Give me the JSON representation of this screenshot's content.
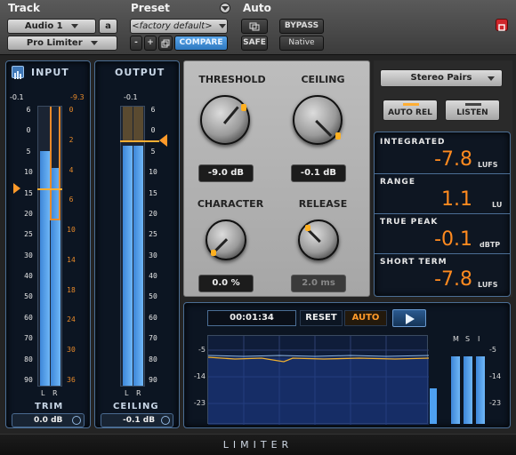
{
  "header": {
    "track_label": "Track",
    "track_name": "Audio 1",
    "track_variant": "a",
    "plugin_name": "Pro Limiter",
    "preset_label": "Preset",
    "preset_name": "<factory default>",
    "minus": "-",
    "plus": "+",
    "compare": "COMPARE",
    "auto_label": "Auto",
    "safe": "SAFE",
    "bypass": "BYPASS",
    "native": "Native"
  },
  "input": {
    "title": "INPUT",
    "peak_left": "-0.1",
    "peak_right": "-9.3",
    "scale_white": [
      "6",
      "0",
      "5",
      "10",
      "15",
      "20",
      "25",
      "30",
      "40",
      "50",
      "60",
      "70",
      "80",
      "90"
    ],
    "scale_orange": [
      "0",
      "2",
      "4",
      "6",
      "10",
      "14",
      "18",
      "24",
      "30",
      "36"
    ],
    "ch_l": "L",
    "ch_r": "R",
    "trim_label": "TRIM",
    "trim_value": "0.0 dB",
    "level_left": 0.84,
    "level_right": 0.78
  },
  "output": {
    "title": "OUTPUT",
    "peak": "-0.1",
    "scale": [
      "6",
      "0",
      "5",
      "10",
      "15",
      "20",
      "25",
      "30",
      "40",
      "50",
      "60",
      "70",
      "80",
      "90"
    ],
    "ch_l": "L",
    "ch_r": "R",
    "ceiling_label": "CEILING",
    "ceiling_value": "-0.1 dB",
    "level_left": 0.86,
    "level_right": 0.86
  },
  "knobs": {
    "threshold_label": "THRESHOLD",
    "threshold_value": "-9.0 dB",
    "ceiling_label": "CEILING",
    "ceiling_value": "-0.1 dB",
    "character_label": "CHARACTER",
    "character_value": "0.0 %",
    "release_label": "RELEASE",
    "release_value": "2.0 ms"
  },
  "loudness": {
    "mode": "Stereo Pairs",
    "auto_rel": "AUTO REL",
    "listen": "LISTEN",
    "integrated_label": "INTEGRATED",
    "integrated_value": "-7.8",
    "integrated_unit": "LUFS",
    "range_label": "RANGE",
    "range_value": "1.1",
    "range_unit": "LU",
    "true_peak_label": "TRUE PEAK",
    "true_peak_value": "-0.1",
    "true_peak_unit": "dBTP",
    "short_term_label": "SHORT TERM",
    "short_term_value": "-7.8",
    "short_term_unit": "LUFS"
  },
  "history": {
    "time": "00:01:34",
    "reset": "RESET",
    "auto": "AUTO",
    "play_icon": "play-icon",
    "ticks": [
      "-5",
      "-14",
      "-23"
    ],
    "ms_labels": [
      "M",
      "S",
      "I"
    ],
    "ms_ticks": [
      "-5",
      "-14",
      "-23"
    ]
  },
  "footer": {
    "title": "LIMITER"
  },
  "colors": {
    "accent": "#ff8a1f",
    "meter_blue": "#4ea0f0",
    "compare_blue": "#3b8fd8",
    "bypass_red": "#d0262b"
  }
}
